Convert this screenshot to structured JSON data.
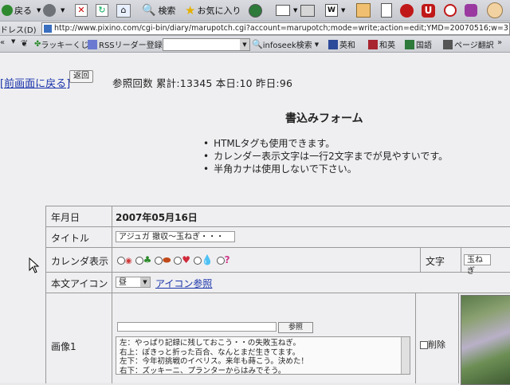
{
  "toolbar": {
    "back": "戻る",
    "search": "検索",
    "favorites": "お気に入り",
    "word_letter": "W"
  },
  "address": {
    "label": "ドレス(D)",
    "url": "http://www.pixino.com/cgi-bin/diary/marupotch.cgi?account=marupotch;mode=write;action=edit;YMD=20070516;w=3"
  },
  "links_bar": {
    "lucky": "ラッキーくじ",
    "rss": "RSSリーダー登録",
    "infoseek": "infoseek検索",
    "eiwa": "英和",
    "waei": "和英",
    "kokugo": "国語",
    "page_translate": "ページ翻訳"
  },
  "page": {
    "back_link": "[前画面に戻る]",
    "back_button": "返回",
    "counter": "参照回数  累計:13345  本日:10  昨日:96",
    "form_title": "書込みフォーム",
    "notes": [
      "HTMLタグも使用できます。",
      "カレンダー表示文字は一行2文字までが見やすいです。",
      "半角カナは使用しないで下さい。"
    ]
  },
  "form": {
    "date_label": "年月日",
    "date_value": "2007年05月16日",
    "title_label": "タイトル",
    "title_value": "アジュガ  撤収～玉ねぎ・・・",
    "calendar_label": "カレンダ表示",
    "text_label": "文字",
    "text_value": "玉ねぎ",
    "icon_label": "本文アイコン",
    "icon_select": "昼",
    "icon_ref": "アイコン参照",
    "image_label": "画像1",
    "browse": "参照",
    "delete": "削除",
    "comment_lines": [
      "左：やっぱり記録に残しておこう・・の失敗玉ねぎ。",
      "右上：ぽきっと折った百合、なんとまだ生きてます。",
      "左下：今年初挑戦のイベリス。来年も蒔こう。決めた！",
      "右下：ズッキーニ、プランターからはみでそう。"
    ]
  }
}
